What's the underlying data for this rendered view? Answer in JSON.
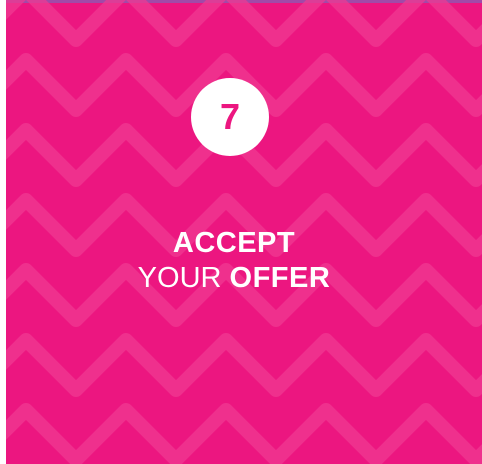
{
  "step": {
    "number": "7"
  },
  "heading": {
    "line1": "ACCEPT",
    "line2_prefix": "YOUR",
    "line2_emphasis": "OFFER"
  },
  "colors": {
    "background": "#ec1680",
    "pattern": "#f03a92",
    "top_border": "#a14aa8",
    "circle": "#ffffff",
    "text": "#ffffff"
  }
}
